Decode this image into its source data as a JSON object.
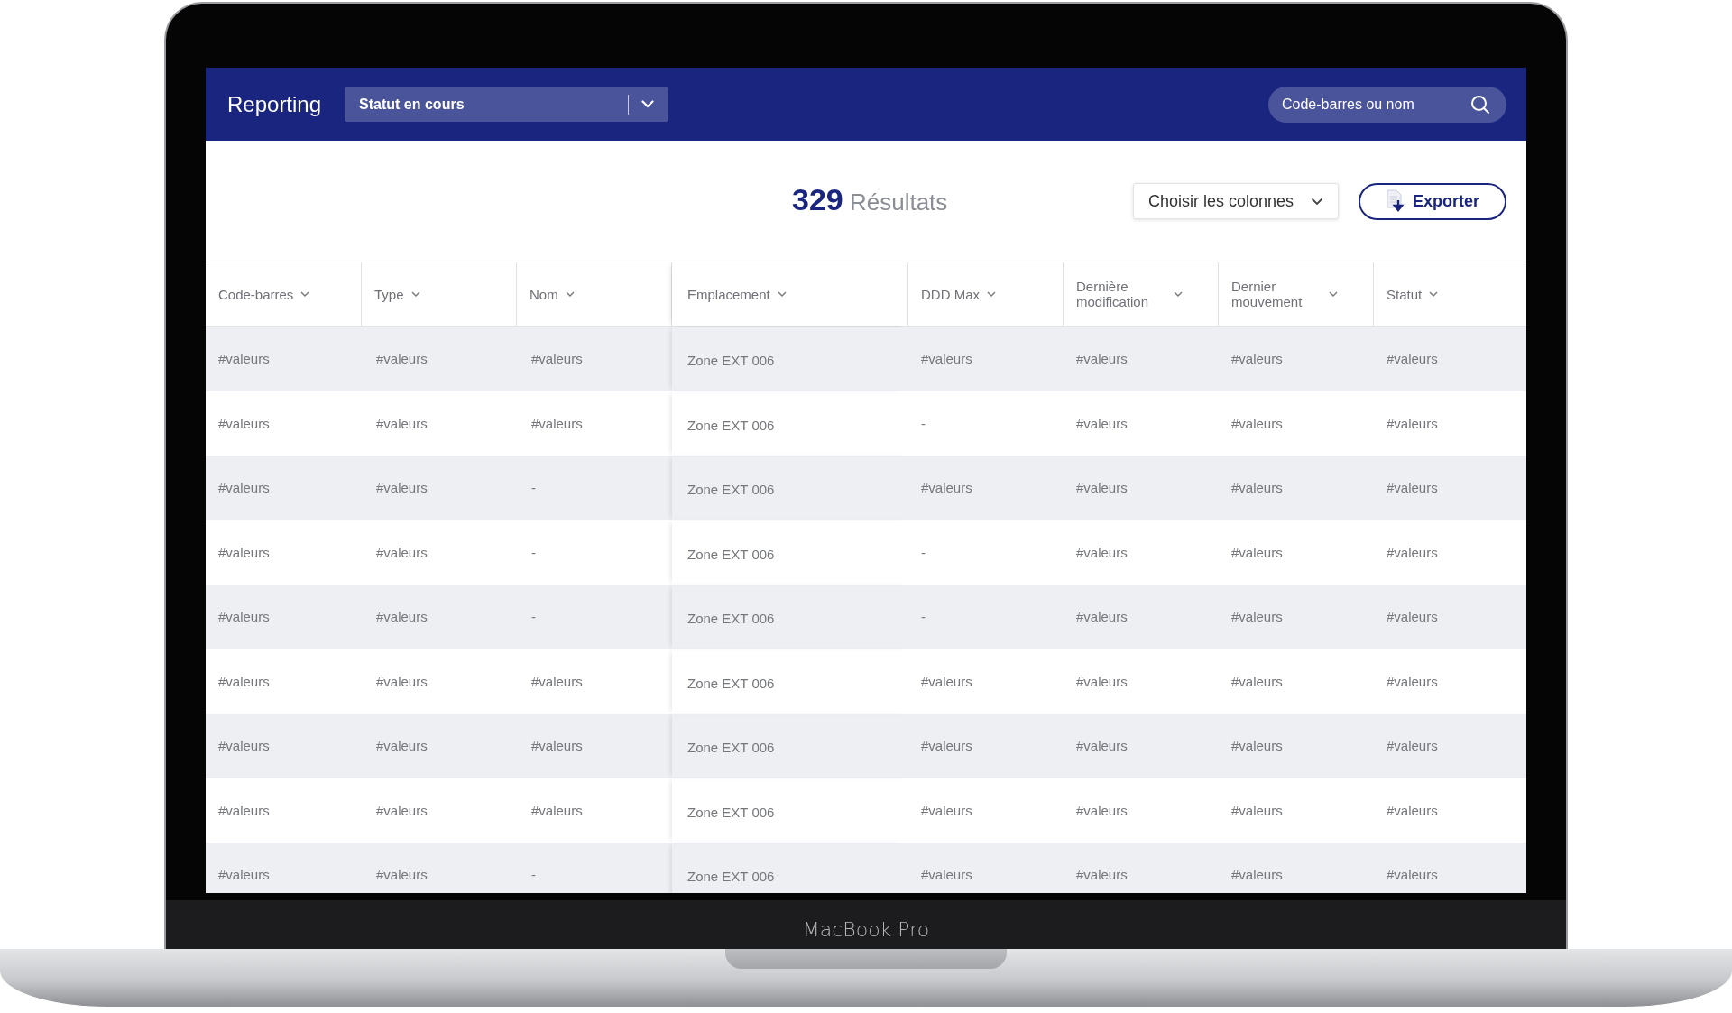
{
  "header": {
    "title": "Reporting",
    "status_filter": {
      "value": "Statut en cours"
    },
    "search": {
      "placeholder": "Code-barres ou nom"
    }
  },
  "toolbar": {
    "count": "329",
    "count_label": "Résultats",
    "columns_button": "Choisir les colonnes",
    "export_button": "Exporter"
  },
  "table": {
    "columns": [
      "Code-barres",
      "Type",
      "Nom",
      "Emplacement",
      "DDD Max",
      "Dernière modification",
      "Dernier mouvement",
      "Statut"
    ],
    "rows": [
      [
        "#valeurs",
        "#valeurs",
        "#valeurs",
        "Zone EXT 006",
        "#valeurs",
        "#valeurs",
        "#valeurs",
        "#valeurs"
      ],
      [
        "#valeurs",
        "#valeurs",
        "#valeurs",
        "Zone EXT 006",
        "-",
        "#valeurs",
        "#valeurs",
        "#valeurs"
      ],
      [
        "#valeurs",
        "#valeurs",
        "-",
        "Zone EXT 006",
        "#valeurs",
        "#valeurs",
        "#valeurs",
        "#valeurs"
      ],
      [
        "#valeurs",
        "#valeurs",
        "-",
        "Zone EXT 006",
        "-",
        "#valeurs",
        "#valeurs",
        "#valeurs"
      ],
      [
        "#valeurs",
        "#valeurs",
        "-",
        "Zone EXT 006",
        "-",
        "#valeurs",
        "#valeurs",
        "#valeurs"
      ],
      [
        "#valeurs",
        "#valeurs",
        "#valeurs",
        "Zone EXT 006",
        "#valeurs",
        "#valeurs",
        "#valeurs",
        "#valeurs"
      ],
      [
        "#valeurs",
        "#valeurs",
        "#valeurs",
        "Zone EXT 006",
        "#valeurs",
        "#valeurs",
        "#valeurs",
        "#valeurs"
      ],
      [
        "#valeurs",
        "#valeurs",
        "#valeurs",
        "Zone EXT 006",
        "#valeurs",
        "#valeurs",
        "#valeurs",
        "#valeurs"
      ],
      [
        "#valeurs",
        "#valeurs",
        "-",
        "Zone EXT 006",
        "#valeurs",
        "#valeurs",
        "#valeurs",
        "#valeurs"
      ]
    ]
  },
  "device_label": "MacBook Pro"
}
